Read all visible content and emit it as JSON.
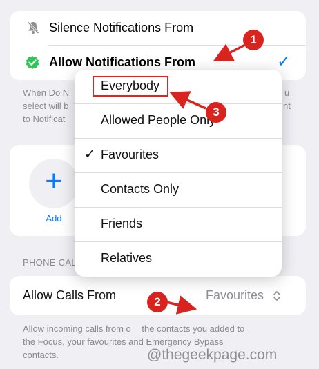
{
  "top_card": {
    "silence_label": "Silence Notifications From",
    "silence_icon": "bell-slash-icon",
    "allow_label": "Allow Notifications From",
    "allow_icon": "green-check-badge-icon",
    "checkmark": "✓"
  },
  "people_footer": {
    "line1": "When Do N",
    "line1_right": "u",
    "line2": "select will b",
    "line2_right": "nt",
    "line3": "to Notificat"
  },
  "add_card": {
    "plus": "+",
    "add_label": "Add"
  },
  "section_header": "PHONE CAL",
  "calls_card": {
    "label": "Allow Calls From",
    "value": "Favourites",
    "chevron": "⌃⌄"
  },
  "calls_footer": {
    "line1": "Allow incoming calls from o",
    "line1_rest": "the contacts you added to",
    "line2": "the Focus, your favourites and Emergency Bypass",
    "line3": "contacts."
  },
  "menu": {
    "items": [
      {
        "label": "Everybody",
        "checked": false
      },
      {
        "label": "Allowed People Only",
        "checked": false
      },
      {
        "label": "Favourites",
        "checked": true
      },
      {
        "label": "Contacts Only",
        "checked": false
      },
      {
        "label": "Friends",
        "checked": false
      },
      {
        "label": "Relatives",
        "checked": false
      }
    ],
    "check_glyph": "✓"
  },
  "annotations": {
    "badge1": "1",
    "badge2": "2",
    "badge3": "3",
    "color": "#d8231f"
  },
  "watermark": "@thegeekpage.com",
  "colors": {
    "accent_blue": "#0a7aff",
    "green": "#30c759",
    "background": "#efeff4"
  }
}
